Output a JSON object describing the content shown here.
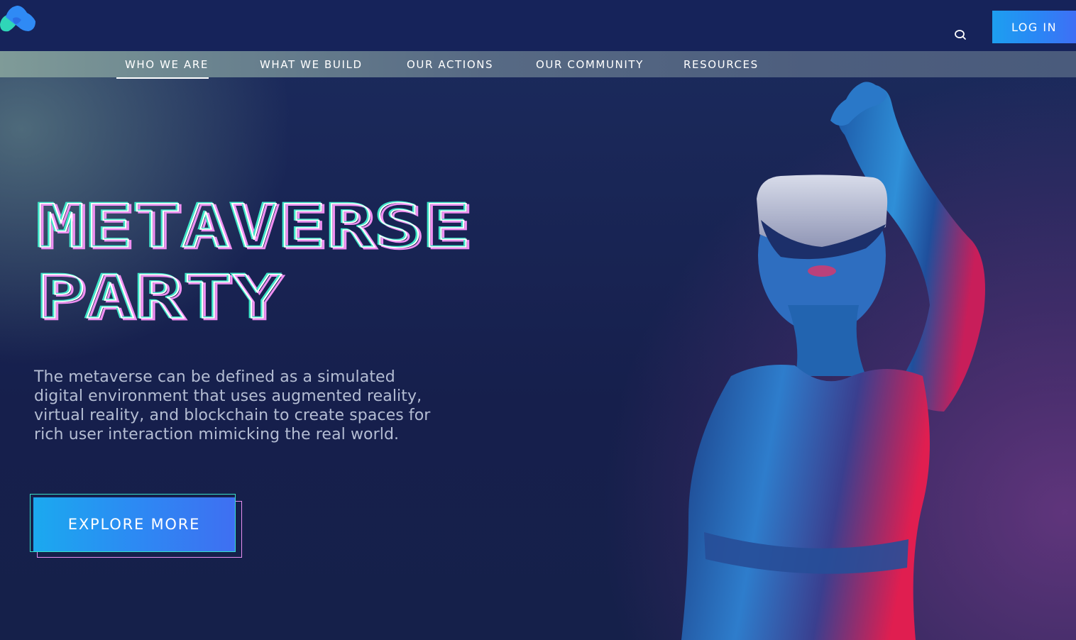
{
  "header": {
    "logo_icon": "brand-logo-icon",
    "search_icon": "search-icon",
    "login_label": "LOG IN"
  },
  "nav": {
    "items": [
      {
        "label": "WHO WE ARE",
        "active": true
      },
      {
        "label": "WHAT WE BUILD",
        "active": false
      },
      {
        "label": "OUR ACTIONS",
        "active": false
      },
      {
        "label": "OUR COMMUNITY",
        "active": false
      },
      {
        "label": "RESOURCES",
        "active": false
      }
    ]
  },
  "hero": {
    "title_line1": "METAVERSE",
    "title_line2": "PARTY",
    "description": "The metaverse can be defined as a simulated digital environment that uses augmented reality, virtual reality, and blockchain to create spaces for rich user interaction mimicking the real world.",
    "cta_label": "EXPLORE MORE"
  },
  "colors": {
    "background": "#15204e",
    "topbar": "#16235a",
    "accent_blue": "#1d9ff0",
    "accent_teal": "#39e0c8",
    "accent_pink": "#e88ff0",
    "text_muted": "#b4bdd3"
  }
}
